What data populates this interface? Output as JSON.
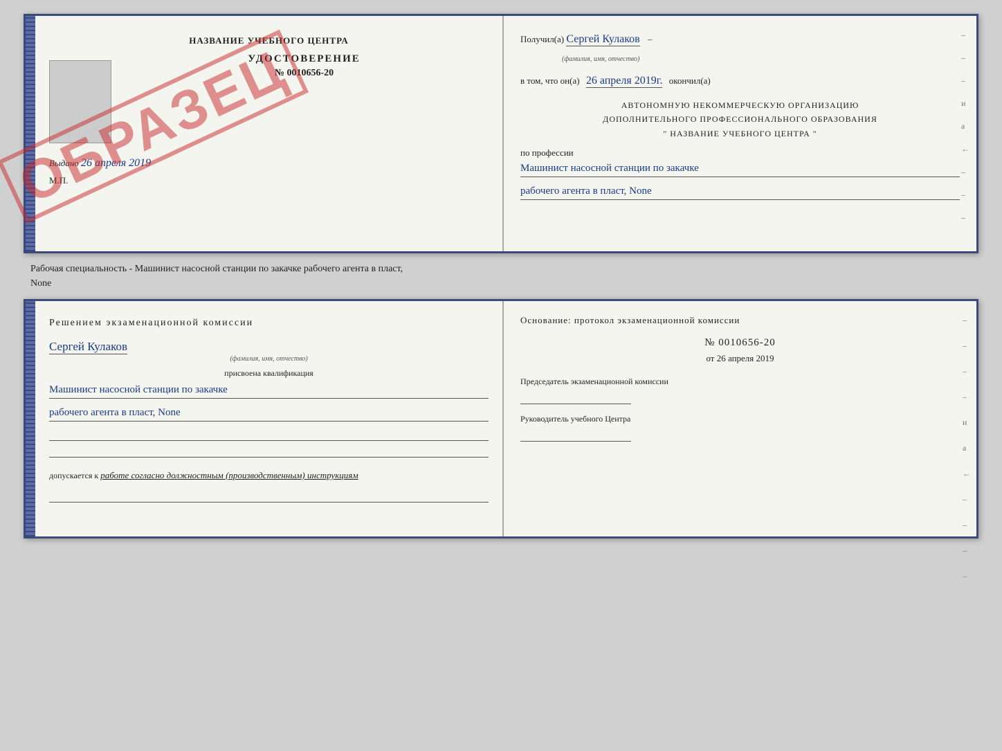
{
  "top_booklet": {
    "left": {
      "title": "НАЗВАНИЕ УЧЕБНОГО ЦЕНТРА",
      "udostoverenie": "УДОСТОВЕРЕНИЕ",
      "number": "№ 0010656-20",
      "issued_label": "Выдано",
      "issued_date": "26 апреля 2019",
      "mp_label": "М.П.",
      "watermark": "ОБРАЗЕЦ"
    },
    "right": {
      "poluchil_label": "Получил(а)",
      "poluchil_name": "Сергей Кулаков",
      "familiya_label": "(фамилия, имя, отчество)",
      "vtom_label": "в том, что он(а)",
      "vtom_date": "26 апреля 2019г.",
      "okonchil_label": "окончил(а)",
      "org_line1": "АВТОНОМНУЮ НЕКОММЕРЧЕСКУЮ ОРГАНИЗАЦИЮ",
      "org_line2": "ДОПОЛНИТЕЛЬНОГО ПРОФЕССИОНАЛЬНОГО ОБРАЗОВАНИЯ",
      "org_line3": "\"  НАЗВАНИЕ УЧЕБНОГО ЦЕНТРА  \"",
      "po_professii": "по профессии",
      "profession_line1": "Машинист насосной станции по закачке",
      "profession_line2": "рабочего агента в пласт, None",
      "dash_lines": [
        "-",
        "-",
        "-",
        "и",
        "а",
        "←",
        "-",
        "-",
        "-"
      ]
    }
  },
  "info_text": {
    "line1": "Рабочая специальность - Машинист насосной станции по закачке рабочего агента в пласт,",
    "line2": "None"
  },
  "bottom_booklet": {
    "left": {
      "reshen_title": "Решением экзаменационной комиссии",
      "name": "Сергей Кулаков",
      "familiya_label": "(фамилия, имя, отчество)",
      "prisvoyena": "присвоена квалификация",
      "qualification_line1": "Машинист насосной станции по закачке",
      "qualification_line2": "рабочего агента в пласт, None",
      "dopuskaetsya": "допускается к",
      "dopusk_text": "работе согласно должностным (производственным) инструкциям"
    },
    "right": {
      "osnov_title": "Основание: протокол экзаменационной комиссии",
      "number": "№  0010656-20",
      "ot_label": "от",
      "date": "26 апреля 2019",
      "predsedatel_title": "Председатель экзаменационной комиссии",
      "rukovoditel_title": "Руководитель учебного Центра",
      "dash_lines": [
        "-",
        "-",
        "-",
        "-",
        "и",
        "а",
        "←",
        "-",
        "-",
        "-",
        "-"
      ]
    }
  }
}
